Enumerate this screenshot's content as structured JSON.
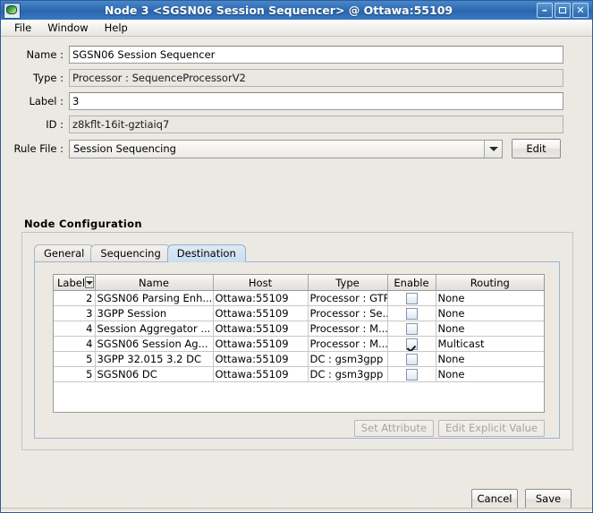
{
  "window": {
    "title": "Node 3 <SGSN06 Session Sequencer> @ Ottawa:55109",
    "icon": "app-icon",
    "buttons": {
      "minimize": "–",
      "maximize": "",
      "close": "✕"
    }
  },
  "menubar": {
    "items": [
      {
        "label": "File"
      },
      {
        "label": "Window"
      },
      {
        "label": "Help"
      }
    ]
  },
  "form": {
    "name": {
      "label": "Name :",
      "value": "SGSN06 Session Sequencer",
      "readonly": false
    },
    "type": {
      "label": "Type :",
      "value": "Processor : SequenceProcessorV2",
      "readonly": true
    },
    "label": {
      "label": "Label :",
      "value": "3",
      "readonly": false
    },
    "id": {
      "label": "ID :",
      "value": "z8kflt-16it-gztiaiq7",
      "readonly": true
    },
    "rule_file": {
      "label": "Rule File :",
      "value": "Session Sequencing",
      "edit_button": "Edit"
    }
  },
  "node_configuration": {
    "title": "Node  Configuration",
    "tabs": [
      {
        "label": "General",
        "active": false
      },
      {
        "label": "Sequencing",
        "active": false
      },
      {
        "label": "Destination",
        "active": true
      }
    ],
    "table": {
      "columns": [
        "Label",
        "Name",
        "Host",
        "Type",
        "Enable",
        "Routing"
      ],
      "sort_column": "Label",
      "rows": [
        {
          "label": "2",
          "name": "SGSN06 Parsing Enh...",
          "host": "Ottawa:55109",
          "type": "Processor : GTP",
          "enable": false,
          "routing": "None"
        },
        {
          "label": "3",
          "name": "3GPP Session",
          "host": "Ottawa:55109",
          "type": "Processor : Se...",
          "enable": false,
          "routing": "None"
        },
        {
          "label": "4",
          "name": "Session Aggregator ...",
          "host": "Ottawa:55109",
          "type": "Processor : M...",
          "enable": false,
          "routing": "None"
        },
        {
          "label": "4",
          "name": "SGSN06 Session Ag...",
          "host": "Ottawa:55109",
          "type": "Processor : M...",
          "enable": true,
          "routing": "Multicast"
        },
        {
          "label": "5",
          "name": "3GPP 32.015 3.2 DC",
          "host": "Ottawa:55109",
          "type": "DC : gsm3gpp",
          "enable": false,
          "routing": "None"
        },
        {
          "label": "5",
          "name": "SGSN06 DC",
          "host": "Ottawa:55109",
          "type": "DC : gsm3gpp",
          "enable": false,
          "routing": "None"
        }
      ]
    },
    "attribute_buttons": [
      {
        "label": "Set Attribute",
        "enabled": false
      },
      {
        "label": "Edit Explicit Value",
        "enabled": false
      }
    ]
  },
  "footer": {
    "cancel": "Cancel",
    "save": "Save"
  },
  "colors": {
    "titlebar": "#2f6cb4",
    "window_bg": "#ece9e3",
    "active_tab": "#c9ddf0",
    "panel_border": "#9ab4d2"
  }
}
